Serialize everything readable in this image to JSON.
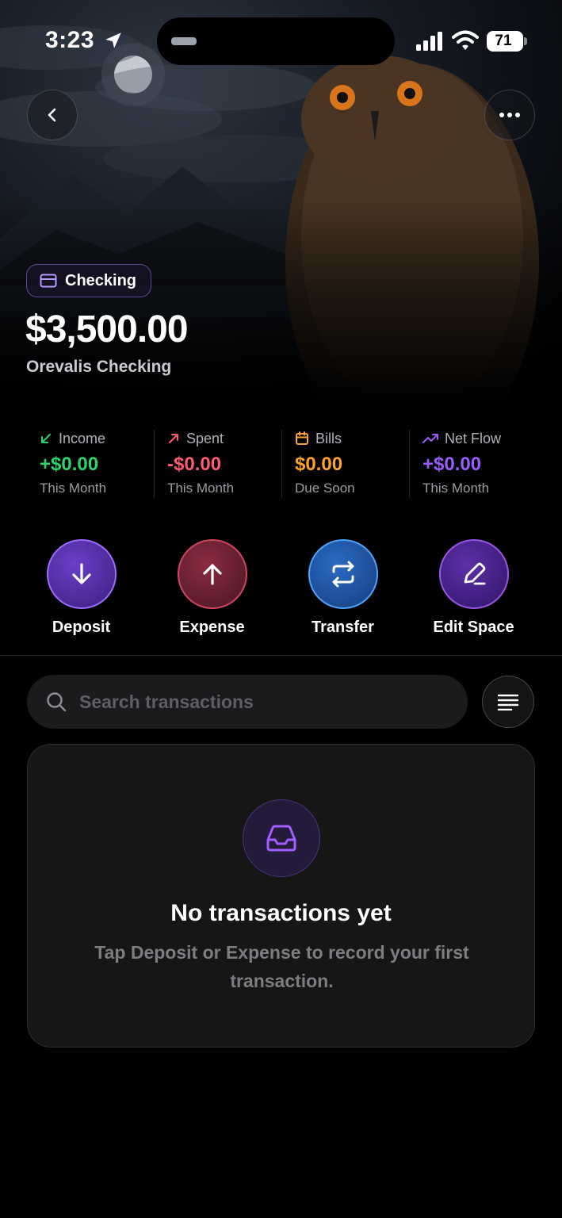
{
  "status_bar": {
    "time": "3:23",
    "battery": "71"
  },
  "account": {
    "type_label": "Checking",
    "balance": "$3,500.00",
    "name": "Orevalis Checking"
  },
  "stats": [
    {
      "label": "Income",
      "value": "+$0.00",
      "sub": "This Month",
      "color": "#2fd36a",
      "icon": "arrow-down-left-icon"
    },
    {
      "label": "Spent",
      "value": "-$0.00",
      "sub": "This Month",
      "color": "#ff5a6e",
      "icon": "arrow-up-right-icon"
    },
    {
      "label": "Bills",
      "value": "$0.00",
      "sub": "Due Soon",
      "color": "#ffa033",
      "icon": "calendar-icon"
    },
    {
      "label": "Net Flow",
      "value": "+$0.00",
      "sub": "This Month",
      "color": "#9b5cff",
      "icon": "trending-up-icon"
    }
  ],
  "actions": [
    {
      "label": "Deposit",
      "icon": "arrow-down-icon"
    },
    {
      "label": "Expense",
      "icon": "arrow-up-icon"
    },
    {
      "label": "Transfer",
      "icon": "repeat-icon"
    },
    {
      "label": "Edit Space",
      "icon": "pencil-icon"
    }
  ],
  "search": {
    "placeholder": "Search transactions"
  },
  "empty_state": {
    "title": "No transactions yet",
    "message": "Tap Deposit or Expense to record your first transaction."
  },
  "colors": {
    "accent_purple": "#9b5cff",
    "income_green": "#2fd36a",
    "spent_red": "#ff5a6e",
    "bills_orange": "#ffa033"
  }
}
